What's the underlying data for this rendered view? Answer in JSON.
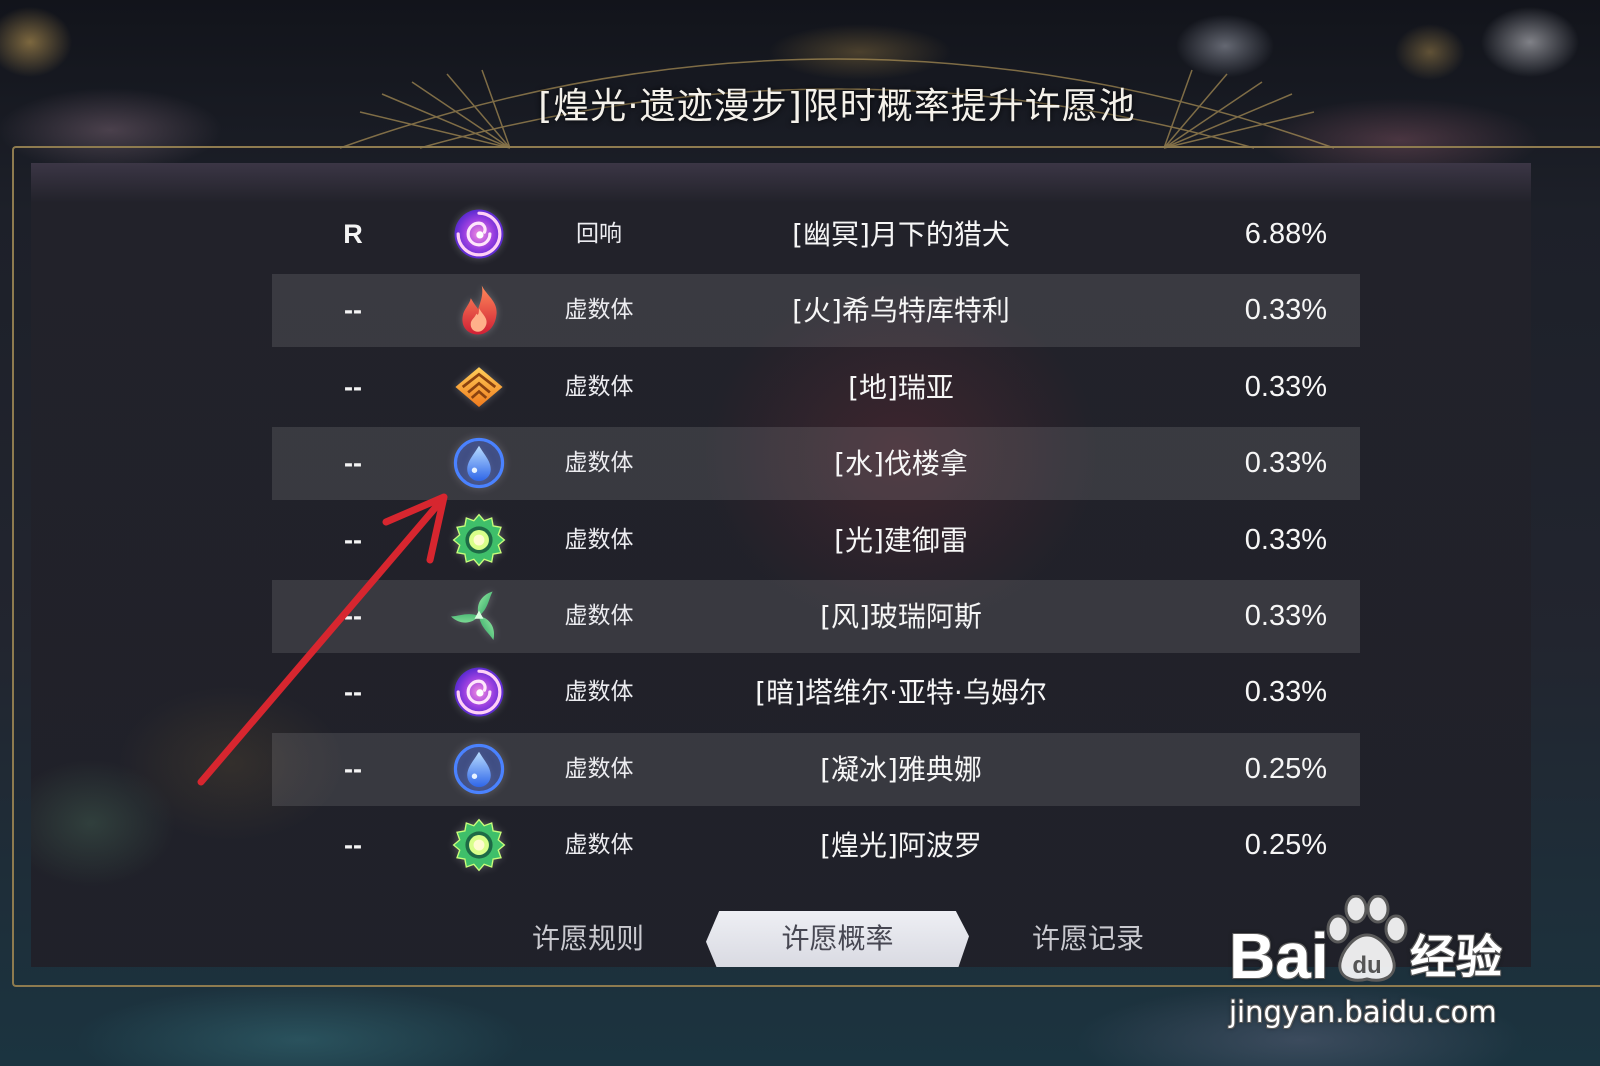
{
  "title": "[煌光·遗迹漫步]限时概率提升许愿池",
  "colors": {
    "accent_gold": "#b79a5a",
    "frame_gold": "#8e7b4f",
    "row_highlight": "rgba(255,255,255,0.11)",
    "selected_tab_bg": "#e4e5ec",
    "arrow": "#d7262f"
  },
  "rows": [
    {
      "rank": "R",
      "icon": "dark-element-icon",
      "type": "回响",
      "name": "[幽冥]月下的猎犬",
      "rate": "6.88%"
    },
    {
      "rank": "--",
      "icon": "fire-element-icon",
      "type": "虚数体",
      "name": "[火]希乌特库特利",
      "rate": "0.33%"
    },
    {
      "rank": "--",
      "icon": "earth-element-icon",
      "type": "虚数体",
      "name": "[地]瑞亚",
      "rate": "0.33%"
    },
    {
      "rank": "--",
      "icon": "water-element-icon",
      "type": "虚数体",
      "name": "[水]伐楼拿",
      "rate": "0.33%"
    },
    {
      "rank": "--",
      "icon": "light-element-icon",
      "type": "虚数体",
      "name": "[光]建御雷",
      "rate": "0.33%"
    },
    {
      "rank": "--",
      "icon": "wind-element-icon",
      "type": "虚数体",
      "name": "[风]玻瑞阿斯",
      "rate": "0.33%"
    },
    {
      "rank": "--",
      "icon": "dark-element-icon",
      "type": "虚数体",
      "name": "[暗]塔维尔·亚特·乌姆尔",
      "rate": "0.33%"
    },
    {
      "rank": "--",
      "icon": "water-element-icon",
      "type": "虚数体",
      "name": "[凝冰]雅典娜",
      "rate": "0.25%"
    },
    {
      "rank": "--",
      "icon": "light-element-icon",
      "type": "虚数体",
      "name": "[煌光]阿波罗",
      "rate": "0.25%"
    }
  ],
  "tabs": [
    {
      "label": "许愿规则",
      "selected": false
    },
    {
      "label": "许愿概率",
      "selected": true
    },
    {
      "label": "许愿记录",
      "selected": false
    }
  ],
  "watermark": {
    "logo_left": "Bai",
    "logo_paw": "du",
    "logo_right": "经验",
    "url": "jingyan.baidu.com"
  }
}
